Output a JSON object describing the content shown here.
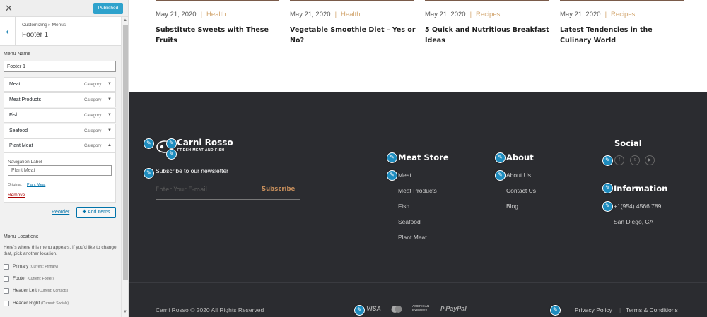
{
  "customizer": {
    "published_label": "Published",
    "breadcrumb": "Customizing ▸ Menus",
    "section_title": "Footer 1",
    "menu_name_label": "Menu Name",
    "menu_name_value": "Footer 1",
    "items": [
      {
        "title": "Meat",
        "type": "Category"
      },
      {
        "title": "Meat Products",
        "type": "Category"
      },
      {
        "title": "Fish",
        "type": "Category"
      },
      {
        "title": "Seafood",
        "type": "Category"
      },
      {
        "title": "Plant Meat",
        "type": "Category"
      }
    ],
    "open_item": {
      "nav_label": "Navigation Label",
      "nav_value": "Plant Meat",
      "original_label": "Original:",
      "original_link": "Plant Meat",
      "remove": "Remove"
    },
    "reorder": "Reorder",
    "add_items": "Add Items",
    "locations_title": "Menu Locations",
    "locations_desc": "Here's where this menu appears. If you'd like to change that, pick another location.",
    "locations": [
      {
        "name": "Primary",
        "current": "(Current: Primary)"
      },
      {
        "name": "Footer",
        "current": "(Current: Footer)"
      },
      {
        "name": "Header Left",
        "current": "(Current: Contacts)"
      },
      {
        "name": "Header Right",
        "current": "(Current: Socials)"
      }
    ]
  },
  "posts": [
    {
      "date": "May 21, 2020",
      "category": "Health",
      "title": "Substitute Sweets with These Fruits"
    },
    {
      "date": "May 21, 2020",
      "category": "Health",
      "title": "Vegetable Smoothie Diet – Yes or No?"
    },
    {
      "date": "May 21, 2020",
      "category": "Recipes",
      "title": "5 Quick and Nutritious Breakfast Ideas"
    },
    {
      "date": "May 21, 2020",
      "category": "Recipes",
      "title": "Latest Tendencies in the Culinary World"
    }
  ],
  "footer": {
    "brand": "Carni Rosso",
    "brand_tagline": "FRESH MEAT AND FISH",
    "newsletter_title": "Subscribe to our newsletter",
    "email_placeholder": "Enter Your E-mail",
    "subscribe": "Subscribe",
    "meat_store": {
      "title": "Meat Store",
      "links": [
        "Meat",
        "Meat Products",
        "Fish",
        "Seafood",
        "Plant Meat"
      ]
    },
    "about": {
      "title": "About",
      "links": [
        "About Us",
        "Contact Us",
        "Blog"
      ]
    },
    "social_title": "Social",
    "social_icons": [
      "facebook-icon",
      "twitter-icon",
      "youtube-icon"
    ],
    "information": {
      "title": "Information",
      "phone": "+1(954) 4566 789",
      "city": "San Diego, CA"
    },
    "copyright": "Carni Rosso © 2020 All Rights Reserved",
    "payments": {
      "visa": "VISA",
      "amex_line1": "AMERICAN",
      "amex_line2": "EXPRESS",
      "paypal": "PayPal"
    },
    "privacy": "Privacy Policy",
    "separator": "|",
    "terms": "Terms & Conditions"
  },
  "colors": {
    "accent": "#d2a56e",
    "footer_bg": "#2b2c30",
    "edit_shortcut": "#1e8cbe",
    "published": "#2ea2cc"
  }
}
